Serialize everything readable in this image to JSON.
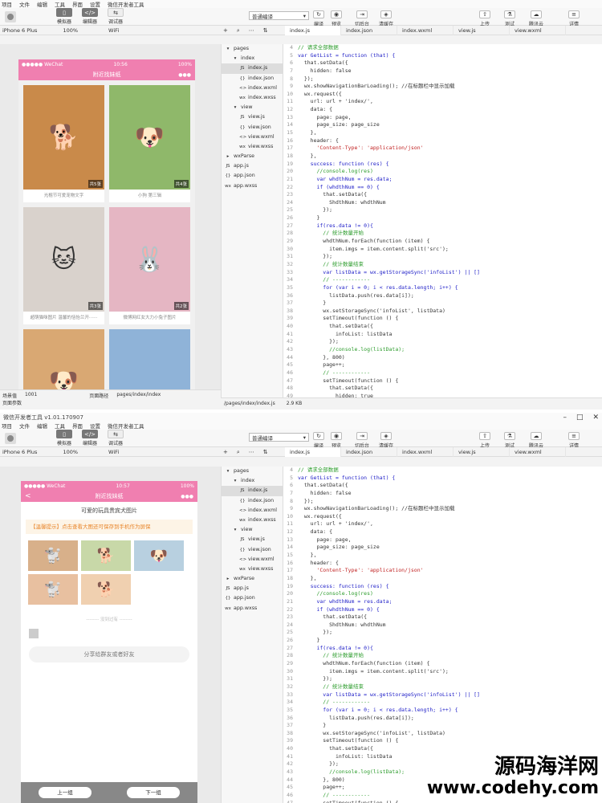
{
  "window1": {
    "menu": [
      "项目",
      "文件",
      "编辑",
      "工具",
      "界面",
      "设置",
      "微信开发者工具"
    ],
    "toolbar": {
      "simulator": "模拟器",
      "editor": "编辑器",
      "debugger": "调试器",
      "compile_mode": "普通编译",
      "compile": "编译",
      "preview": "预览",
      "cut_backend": "切后台",
      "clear_cache": "清缓存",
      "upload": "上传",
      "test": "测试",
      "tencent_cloud": "腾讯云",
      "details": "详情"
    },
    "device": "iPhone 6 Plus",
    "zoom": "100%",
    "network": "WiFi",
    "tabs": [
      "index.js",
      "index.json",
      "index.wxml",
      "view.js",
      "view.wxml"
    ],
    "phone": {
      "carrier": "●●●●● WeChat",
      "time": "10:56",
      "battery": "100%",
      "nav_title": "附近找妹纸",
      "dots": "●●●"
    },
    "cards": [
      {
        "count": "共5张",
        "caption": "光棍节可爱宠物文字",
        "emoji": "🐕",
        "color": "#c98a4a"
      },
      {
        "count": "共4张",
        "caption": "小狗 第三辑",
        "emoji": "🐶",
        "color": "#8fb86a"
      },
      {
        "count": "共3张",
        "caption": "超萌猫咪图片 温馨的恬怡兰开······",
        "emoji": "🐱",
        "color": "#d9d2cc"
      },
      {
        "count": "共2张",
        "caption": "微博网红女大力小兔子图片",
        "emoji": "🐰",
        "color": "#e5b6c3"
      },
      {
        "count": "",
        "caption": "",
        "emoji": "🐶",
        "color": "#d9a873"
      },
      {
        "count": "",
        "caption": "",
        "emoji": "",
        "color": "#8fb3d8"
      }
    ],
    "footer": {
      "scene_label": "场景值",
      "scene_value": "1001",
      "path_label": "页面路径",
      "path_value": "pages/index/index",
      "params": "页面参数"
    },
    "path_file": "/pages/index/index.js",
    "path_size": "2.9 KB"
  },
  "window2": {
    "title": "微信开发者工具 v1.01.170907",
    "menu": [
      "项目",
      "文件",
      "编辑",
      "工具",
      "界面",
      "设置",
      "微信开发者工具"
    ],
    "toolbar": {
      "simulator": "模拟器",
      "editor": "编辑器",
      "debugger": "调试器",
      "compile_mode": "普通编译",
      "compile": "编译",
      "preview": "预览",
      "cut_backend": "切后台",
      "clear_cache": "清缓存",
      "upload": "上传",
      "test": "测试",
      "tencent_cloud": "腾讯云",
      "details": "详情"
    },
    "device": "iPhone 6 Plus",
    "zoom": "100%",
    "network": "WiFi",
    "tabs": [
      "index.js",
      "index.json",
      "index.wxml",
      "view.js",
      "view.wxml"
    ],
    "phone": {
      "carrier": "●●●●● WeChat",
      "time": "10:57",
      "battery": "100%",
      "nav_title": "附近找妹纸",
      "dots": "●●●",
      "back": "<"
    },
    "page_title": "可爱的玩具贵宾犬图片",
    "notice": "【温馨提示】点击查看大图还可保存到手机作为屏保",
    "thumbs": [
      "🐩",
      "🐕",
      "🐶",
      "🐩",
      "🐕"
    ],
    "divider": "-------- 没到过有 --------",
    "share": "分享给群友或者好友",
    "prev": "上一组",
    "next": "下一组"
  },
  "filetree": [
    {
      "n": "pages",
      "i": "▾",
      "d": 0
    },
    {
      "n": "index",
      "i": "▾",
      "d": 1
    },
    {
      "n": "index.js",
      "i": "JS",
      "d": 2,
      "a": 1
    },
    {
      "n": "index.json",
      "i": "{}",
      "d": 2
    },
    {
      "n": "index.wxml",
      "i": "<>",
      "d": 2
    },
    {
      "n": "index.wxss",
      "i": "wx",
      "d": 2
    },
    {
      "n": "view",
      "i": "▾",
      "d": 1
    },
    {
      "n": "view.js",
      "i": "JS",
      "d": 2
    },
    {
      "n": "view.json",
      "i": "{}",
      "d": 2
    },
    {
      "n": "view.wxml",
      "i": "<>",
      "d": 2
    },
    {
      "n": "view.wxss",
      "i": "wx",
      "d": 2
    },
    {
      "n": "wxParse",
      "i": "▸",
      "d": 0
    },
    {
      "n": "app.js",
      "i": "JS",
      "d": 0
    },
    {
      "n": "app.json",
      "i": "{}",
      "d": 0
    },
    {
      "n": "app.wxss",
      "i": "wx",
      "d": 0
    }
  ],
  "code_start": 4,
  "code": [
    "// 请求全部数据",
    "var GetList = function (that) {",
    "  that.setData({",
    "    hidden: false",
    "  });",
    "  wx.showNavigationBarLoading(); //在标题栏中显示加载",
    "  wx.request({",
    "    url: url + 'index/',",
    "    data: {",
    "      page: page,",
    "      page_size: page_size",
    "    },",
    "    header: {",
    "      'Content-Type': 'application/json'",
    "    },",
    "    success: function (res) {",
    "      //console.log(res)",
    "      var whdthNum = res.data;",
    "      if (whdthNum == 0) {",
    "        that.setData({",
    "          ShdthNum: whdthNum",
    "        });",
    "      }",
    "      if(res.data != 0){",
    "        // 统计数量开始",
    "        whdthNum.forEach(function (item) {",
    "          item.imgs = item.content.split('src');",
    "        });",
    "        // 统计数量结束",
    "        var listData = wx.getStorageSync('infoList') || []",
    "        // ------------",
    "        for (var i = 0; i < res.data.length; i++) {",
    "          listData.push(res.data[i]);",
    "        }",
    "        wx.setStorageSync('infoList', listData)",
    "        setTimeout(function () {",
    "          that.setData({",
    "            infoList: listData",
    "          });",
    "          //console.log(listData);",
    "        }, 800)",
    "        page++;",
    "        // ------------",
    "        setTimeout(function () {",
    "          that.setData({",
    "            hidden: true"
  ],
  "watermark": {
    "line1": "源码海洋网",
    "line2": "www.codehy.com"
  }
}
